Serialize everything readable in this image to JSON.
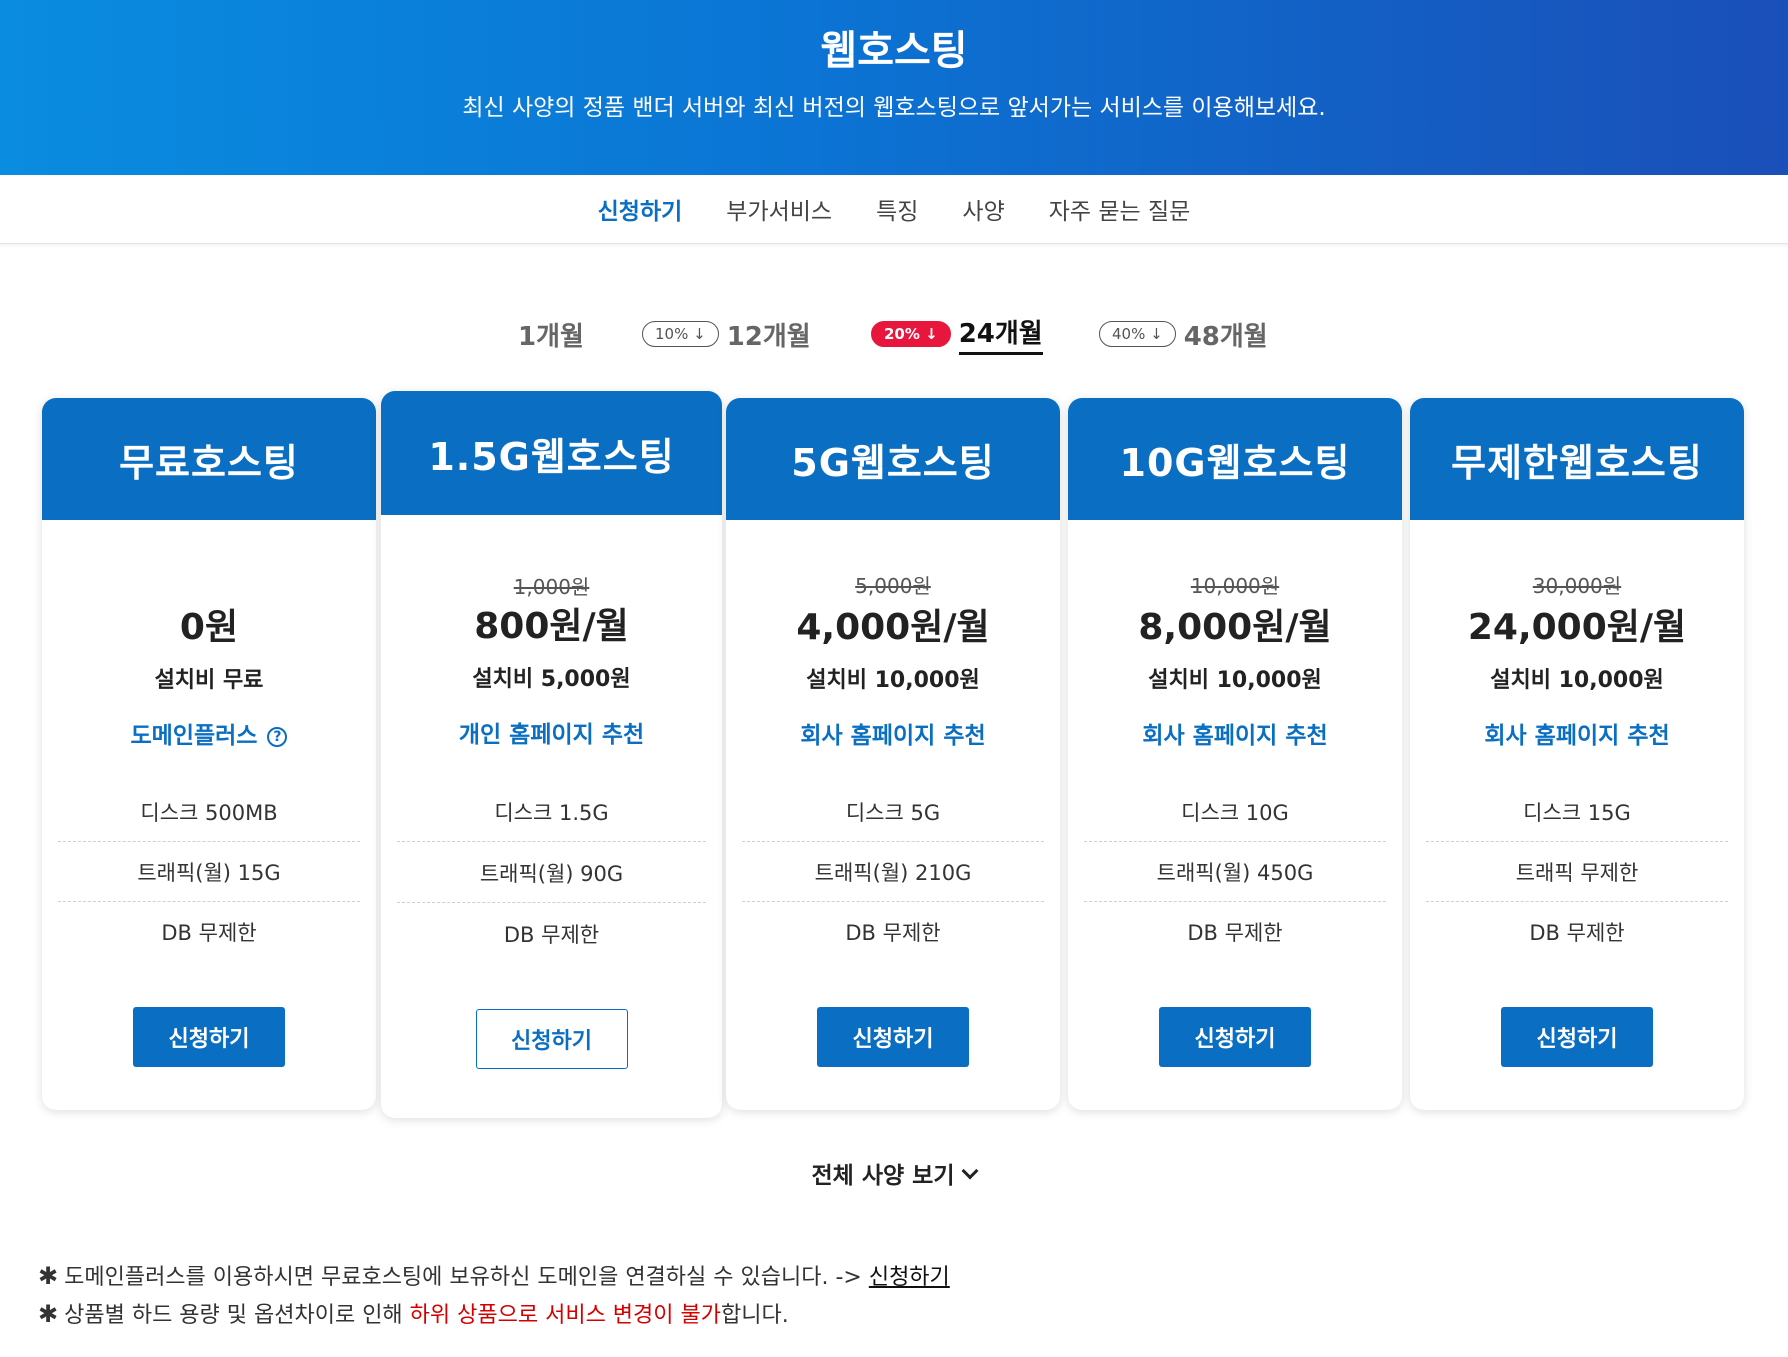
{
  "hero": {
    "title": "웹호스팅",
    "subtitle": "최신 사양의 정품 밴더 서버와 최신 버전의 웹호스팅으로 앞서가는 서비스를 이용해보세요."
  },
  "subnav": {
    "items": [
      {
        "label": "신청하기",
        "active": true
      },
      {
        "label": "부가서비스"
      },
      {
        "label": "특징"
      },
      {
        "label": "사양"
      },
      {
        "label": "자주 묻는 질문"
      }
    ]
  },
  "period_tabs": [
    {
      "label": "1개월",
      "badge": ""
    },
    {
      "label": "12개월",
      "badge": "10% ↓"
    },
    {
      "label": "24개월",
      "badge": "20% ↓",
      "active": true
    },
    {
      "label": "48개월",
      "badge": "40% ↓"
    }
  ],
  "plans": [
    {
      "name": "무료호스팅",
      "old_price": "",
      "price": "0원",
      "setup": "설치비 무료",
      "recommend": "도메인플러스",
      "help_icon": "?",
      "features": [
        "디스크 500MB",
        "트래픽(월) 15G",
        "DB 무제한"
      ],
      "button": "신청하기"
    },
    {
      "name": "1.5G웹호스팅",
      "old_price": "1,000원",
      "price": "800원/월",
      "setup": "설치비 5,000원",
      "recommend": "개인 홈페이지 추천",
      "features": [
        "디스크 1.5G",
        "트래픽(월) 90G",
        "DB 무제한"
      ],
      "button": "신청하기",
      "highlighted": true
    },
    {
      "name": "5G웹호스팅",
      "old_price": "5,000원",
      "price": "4,000원/월",
      "setup": "설치비 10,000원",
      "recommend": "회사 홈페이지 추천",
      "features": [
        "디스크 5G",
        "트래픽(월) 210G",
        "DB 무제한"
      ],
      "button": "신청하기"
    },
    {
      "name": "10G웹호스팅",
      "old_price": "10,000원",
      "price": "8,000원/월",
      "setup": "설치비 10,000원",
      "recommend": "회사 홈페이지 추천",
      "features": [
        "디스크 10G",
        "트래픽(월) 450G",
        "DB 무제한"
      ],
      "button": "신청하기"
    },
    {
      "name": "무제한웹호스팅",
      "old_price": "30,000원",
      "price": "24,000원/월",
      "setup": "설치비 10,000원",
      "recommend": "회사 홈페이지 추천",
      "features": [
        "디스크 15G",
        "트래픽 무제한",
        "DB 무제한"
      ],
      "button": "신청하기"
    }
  ],
  "spec_more": "전체 사양 보기",
  "notes": {
    "star": "✱",
    "line1": {
      "text": "도메인플러스를 이용하시면 무료호스팅에 보유하신 도메인을 연결하실 수 있습니다. -> ",
      "link": "신청하기"
    },
    "line2": {
      "pre": "상품별 하드 용량 및 옵션차이로 인해 ",
      "red": "하위 상품으로 서비스 변경이 불가",
      "post": "합니다."
    }
  },
  "colors": {
    "brand": "#0a6fc2",
    "hot_badge": "#e8163c",
    "warning": "#d40000"
  }
}
